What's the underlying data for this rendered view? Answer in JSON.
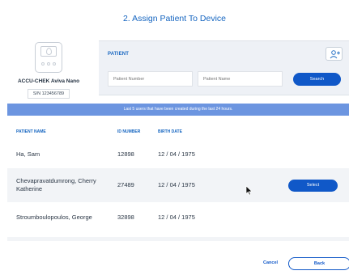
{
  "page": {
    "title": "2. Assign Patient To Device"
  },
  "device": {
    "name": "ACCU-CHEK Aviva Nano",
    "serial": "S/N 123456789",
    "icon": "glucose-meter-icon"
  },
  "patient_panel": {
    "label": "PATIENT",
    "add_icon": "add-person-icon",
    "patient_number": {
      "placeholder": "Patient Number",
      "value": ""
    },
    "patient_name": {
      "placeholder": "Patient Name",
      "value": ""
    },
    "search_label": "Search"
  },
  "banner": {
    "text": "Last 5 users that have been created during the last 24 hours."
  },
  "table": {
    "headers": [
      "PATIENT NAME",
      "ID NUMBER",
      "BIRTH DATE"
    ],
    "rows": [
      {
        "name": "Ha, Sam",
        "id": "12898",
        "birth_date": "12 / 04 / 1975"
      },
      {
        "name": "Chevapravatdumrong, Cherry Katherine",
        "id": "27489",
        "birth_date": "12 / 04 / 1975",
        "action": "Select"
      },
      {
        "name": "Stroumboulopoulos, George",
        "id": "32898",
        "birth_date": "12 / 04 / 1975"
      }
    ]
  },
  "footer": {
    "cancel_label": "Cancel",
    "back_label": "Back"
  },
  "colors": {
    "accent": "#1058c8",
    "title": "#1565c0",
    "banner": "#6c95e0",
    "panel_bg": "#eef1f6"
  }
}
